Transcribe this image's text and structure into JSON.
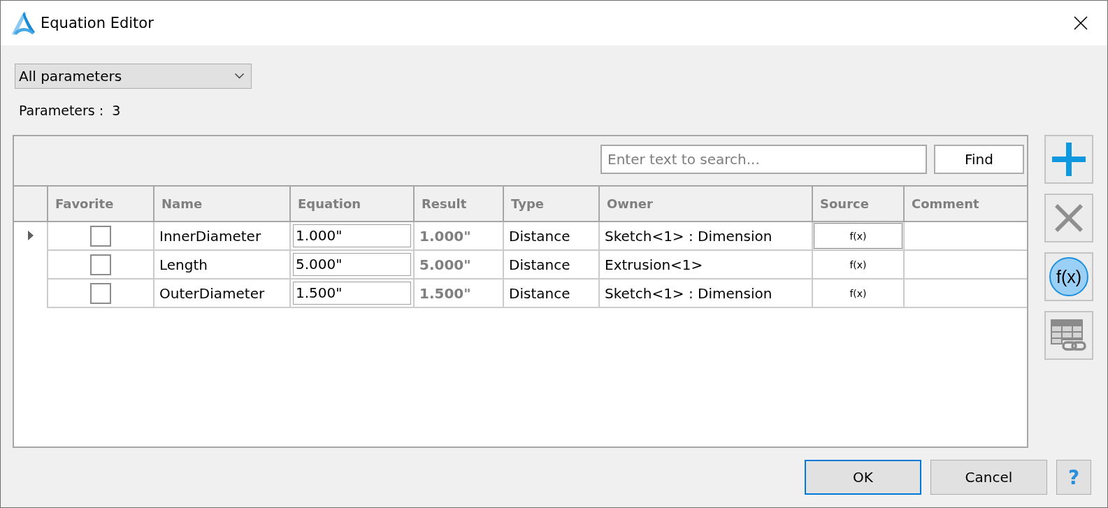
{
  "window": {
    "title": "Equation Editor"
  },
  "filter": {
    "value": "All parameters"
  },
  "parameter_count": {
    "label": "Parameters :",
    "value": "3"
  },
  "search": {
    "placeholder": "Enter text to search...",
    "button": "Find"
  },
  "table": {
    "columns": [
      "Favorite",
      "Name",
      "Equation",
      "Result",
      "Type",
      "Owner",
      "Source",
      "Comment"
    ],
    "rows": [
      {
        "selected": true,
        "favorite": false,
        "name": "InnerDiameter",
        "equation": "1.000\"",
        "result": "1.000\"",
        "type": "Distance",
        "owner": "Sketch<1> : Dimension",
        "source": "f(x)",
        "source_focused": true
      },
      {
        "selected": false,
        "favorite": false,
        "name": "Length",
        "equation": "5.000\"",
        "result": "5.000\"",
        "type": "Distance",
        "owner": "Extrusion<1>",
        "source": "f(x)",
        "source_focused": false
      },
      {
        "selected": false,
        "favorite": false,
        "name": "OuterDiameter",
        "equation": "1.500\"",
        "result": "1.500\"",
        "type": "Distance",
        "owner": "Sketch<1> : Dimension",
        "source": "f(x)",
        "source_focused": false
      }
    ]
  },
  "side_buttons": [
    {
      "kind": "add"
    },
    {
      "kind": "delete"
    },
    {
      "kind": "function",
      "label": "f(x)"
    },
    {
      "kind": "link_table"
    }
  ],
  "buttons": [
    {
      "label": "OK",
      "default": true
    },
    {
      "label": "Cancel",
      "default": false
    }
  ],
  "help": "?"
}
